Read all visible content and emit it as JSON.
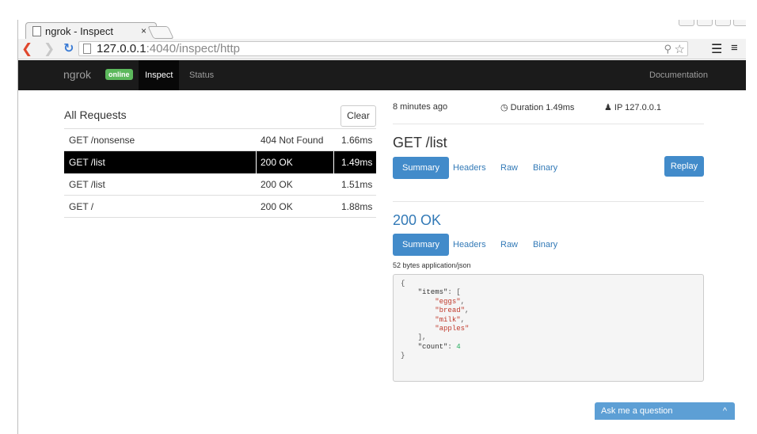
{
  "browser": {
    "tab_title": "ngrok - Inspect",
    "tab_close": "×",
    "url_host": "127.0.0.1",
    "url_rest": ":4040/inspect/http"
  },
  "navbar": {
    "brand": "ngrok",
    "badge": "online",
    "inspect": "Inspect",
    "status": "Status",
    "docs": "Documentation"
  },
  "requests": {
    "title": "All Requests",
    "clear_label": "Clear",
    "rows": [
      {
        "path": "GET /nonsense",
        "status": "404 Not Found",
        "duration": "1.66ms"
      },
      {
        "path": "GET /list",
        "status": "200 OK",
        "duration": "1.49ms"
      },
      {
        "path": "GET /list",
        "status": "200 OK",
        "duration": "1.51ms"
      },
      {
        "path": "GET /",
        "status": "200 OK",
        "duration": "1.88ms"
      }
    ]
  },
  "detail": {
    "time_ago": "8 minutes ago",
    "duration": "Duration  1.49ms",
    "ip": "IP  127.0.0.1",
    "request_heading": "GET /list",
    "response_heading": "200 OK",
    "tabs": [
      "Summary",
      "Headers",
      "Raw",
      "Binary"
    ],
    "replay_label": "Replay",
    "bytes_info": "52 bytes application/json",
    "json_items": [
      "\"eggs\"",
      "\"bread\"",
      "\"milk\"",
      "\"apples\""
    ],
    "json_count": "4"
  },
  "chat": {
    "label": "Ask me a question",
    "caret": "^"
  },
  "colors": {
    "accent": "#428bca",
    "navbar": "#1b1b1b",
    "online": "#5cb85c"
  }
}
